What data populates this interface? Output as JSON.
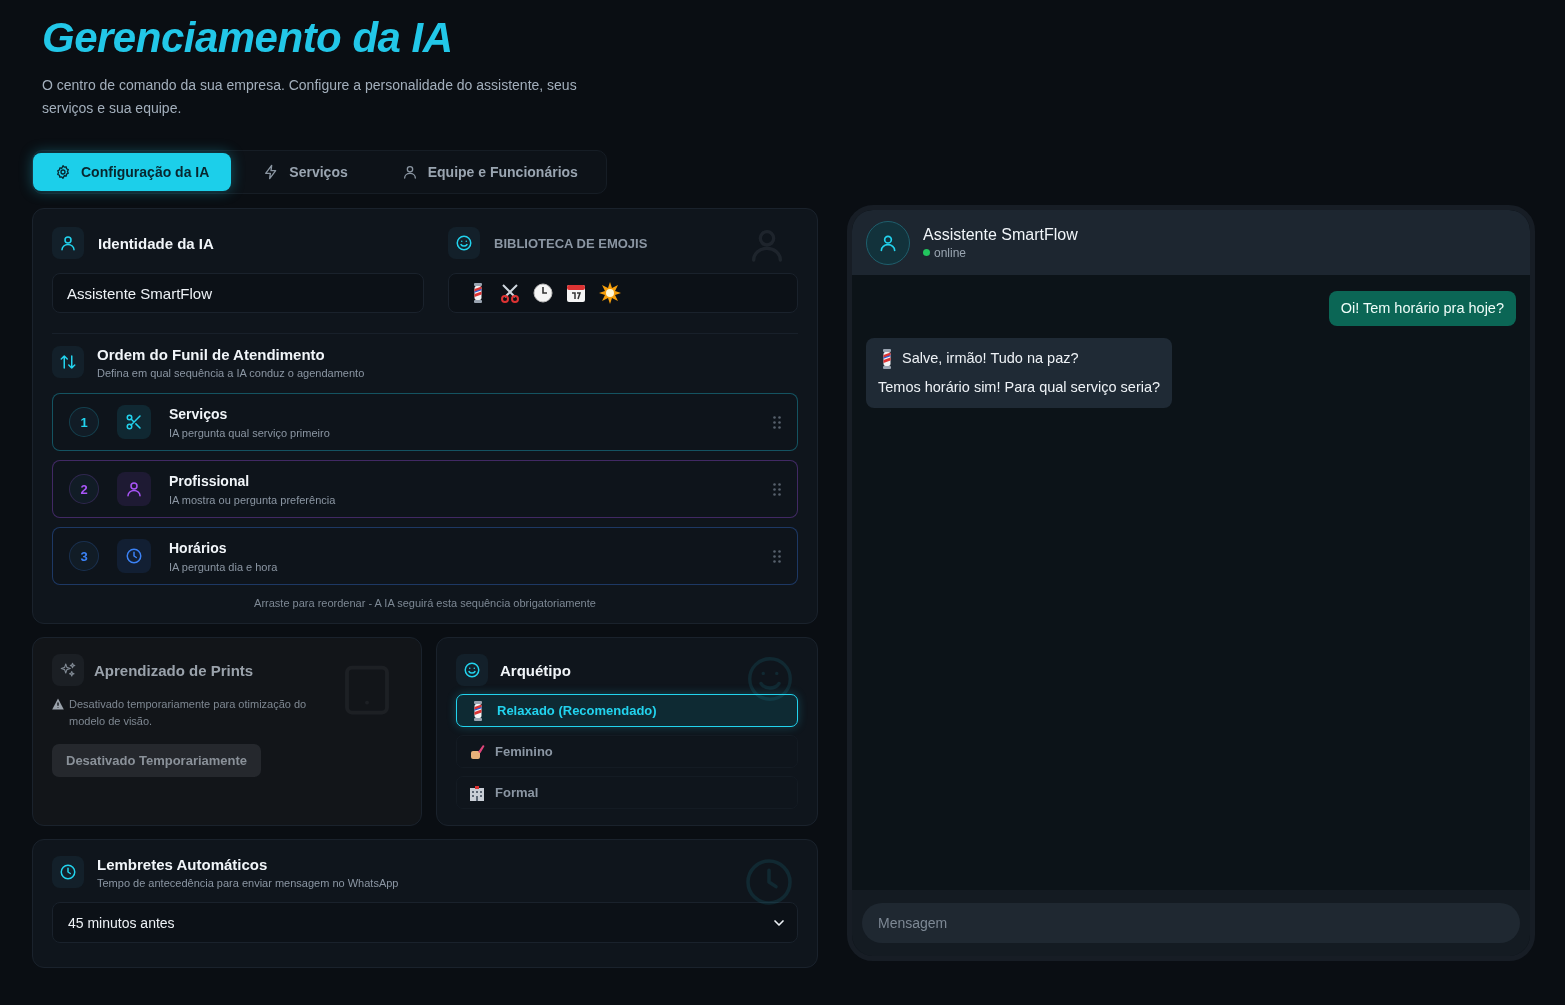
{
  "header": {
    "title": "Gerenciamento da IA",
    "subtitle": "O centro de comando da sua empresa. Configure a personalidade do assistente, seus serviços e sua equipe."
  },
  "tabs": [
    {
      "label": "Configuração da IA",
      "selected": true
    },
    {
      "label": "Serviços",
      "selected": false
    },
    {
      "label": "Equipe e Funcionários",
      "selected": false
    }
  ],
  "identity": {
    "title": "Identidade da IA",
    "name_value": "Assistente SmartFlow"
  },
  "emoji_library": {
    "title": "BIBLIOTECA DE EMOJIS"
  },
  "funnel": {
    "title": "Ordem do Funil de Atendimento",
    "subtitle": "Defina em qual sequência a IA conduz o agendamento",
    "steps": [
      {
        "number": "1",
        "title": "Serviços",
        "description": "IA pergunta qual serviço primeiro",
        "color": "#22d3ee"
      },
      {
        "number": "2",
        "title": "Profissional",
        "description": "IA mostra ou pergunta preferência",
        "color": "#a855f7"
      },
      {
        "number": "3",
        "title": "Horários",
        "description": "IA pergunta dia e hora",
        "color": "#3b82f6"
      }
    ],
    "hint": "Arraste para reordenar - A IA seguirá esta sequência obrigatoriamente"
  },
  "prints": {
    "title": "Aprendizado de Prints",
    "warning": "Desativado temporariamente para otimização do modelo de visão.",
    "button": "Desativado Temporariamente",
    "disabled": true
  },
  "archetype": {
    "title": "Arquétipo",
    "options": [
      {
        "label": "Relaxado (Recomendado)",
        "selected": true
      },
      {
        "label": "Feminino",
        "selected": false
      },
      {
        "label": "Formal",
        "selected": false
      }
    ]
  },
  "reminders": {
    "title": "Lembretes Automáticos",
    "subtitle": "Tempo de antecedência para enviar mensagem no WhatsApp",
    "value": "45 minutos antes"
  },
  "chat": {
    "name": "Assistente SmartFlow",
    "status": "online",
    "messages": [
      {
        "kind": "sent",
        "lines": [
          "Oi! Tem horário pra hoje?"
        ]
      },
      {
        "kind": "received",
        "lines": [
          "Salve, irmão! Tudo na paz?",
          "Temos horário sim! Para qual serviço seria?"
        ]
      }
    ],
    "placeholder": "Mensagem"
  }
}
